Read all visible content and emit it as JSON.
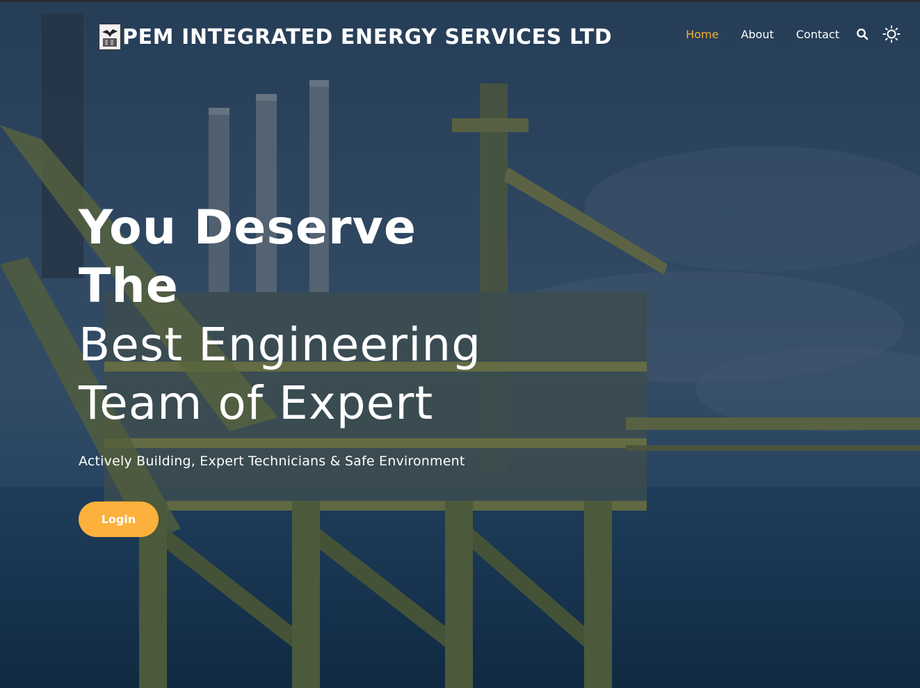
{
  "brand": {
    "name": "PEM INTEGRATED ENERGY SERVICES LTD",
    "logo_icon": "eagle-logo-icon"
  },
  "nav": {
    "items": [
      {
        "label": "Home",
        "active": true
      },
      {
        "label": "About",
        "active": false
      },
      {
        "label": "Contact",
        "active": false
      }
    ],
    "search_icon": "search-icon",
    "theme_icon": "sun-icon"
  },
  "hero": {
    "line1": "You Deserve",
    "line2": "The",
    "line3": "Best Engineering",
    "line4": "Team of Expert",
    "subtitle": "Actively Building, Expert Technicians & Safe Environment",
    "cta_label": "Login"
  },
  "colors": {
    "accent": "#f6b02e",
    "button": "#fbb13c",
    "overlay": "#14263c",
    "text": "#ffffff"
  }
}
